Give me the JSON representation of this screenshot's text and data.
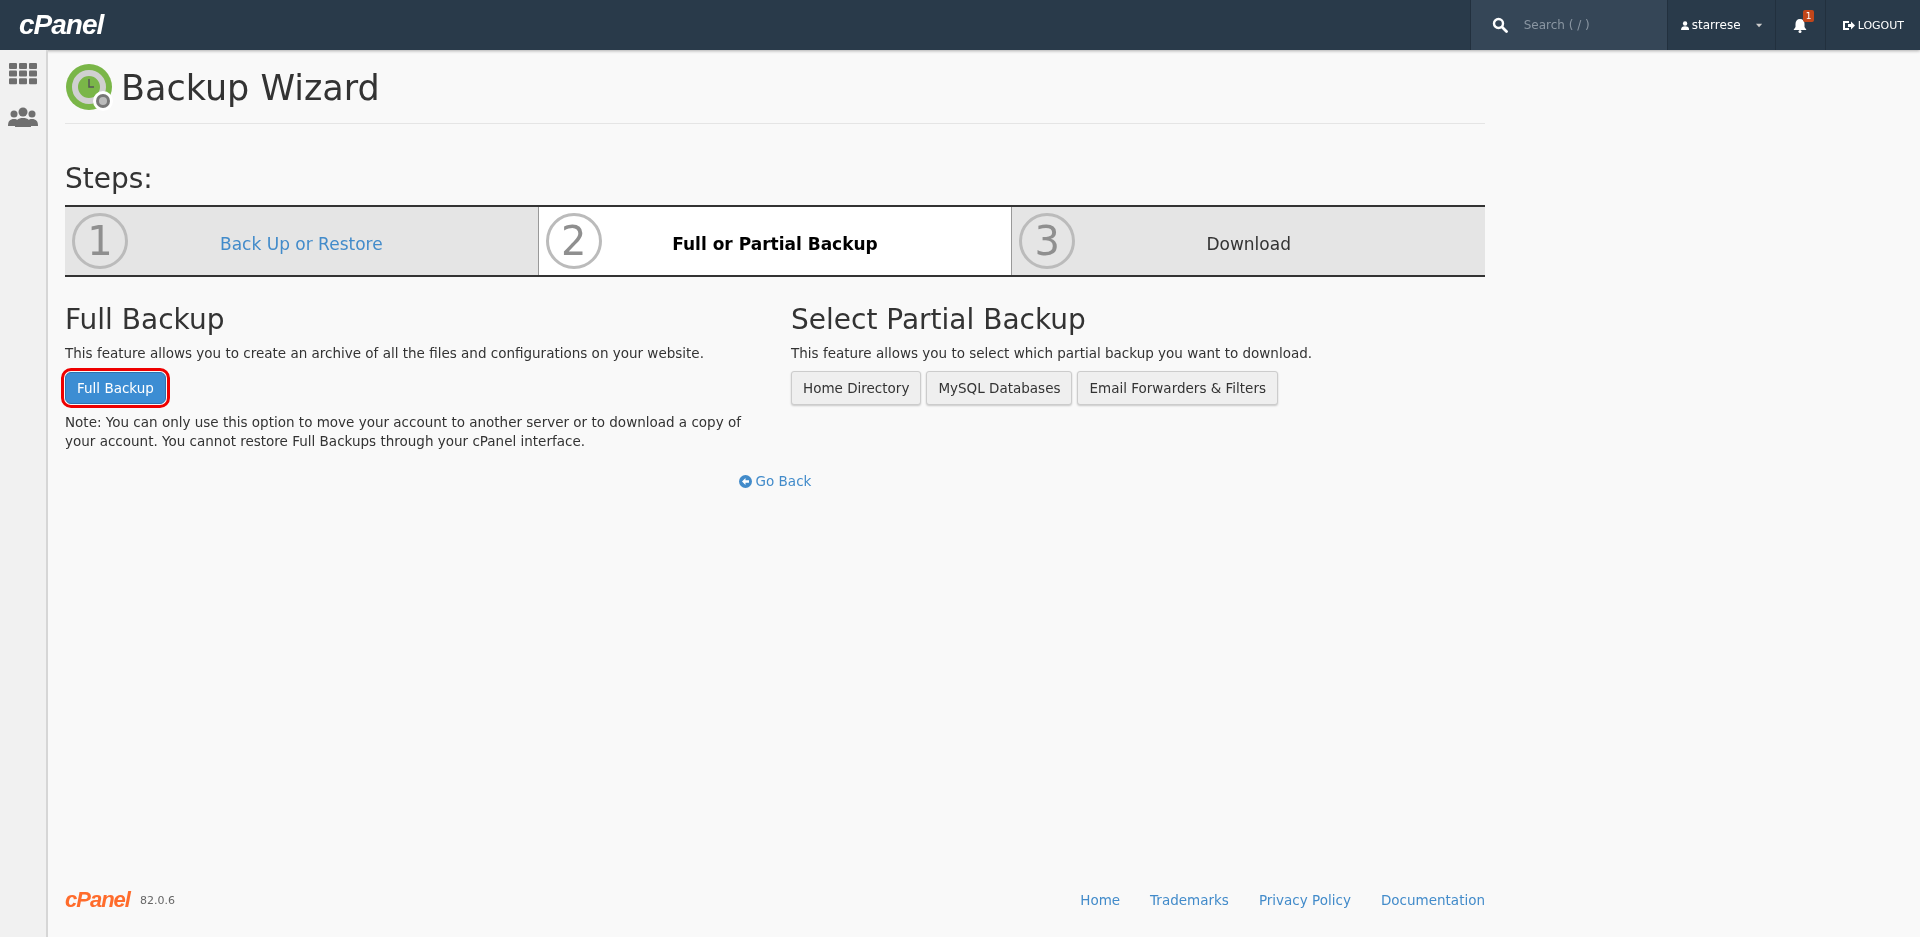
{
  "header": {
    "logo": "cPanel",
    "search": {
      "placeholder": "Search ( / )"
    },
    "user": "starrese",
    "notifications": "1",
    "logout": "LOGOUT"
  },
  "page": {
    "title": "Backup Wizard"
  },
  "steps": {
    "heading": "Steps:",
    "items": [
      {
        "number": "1",
        "label": "Back Up or Restore",
        "selected": false,
        "completed": true
      },
      {
        "number": "2",
        "label": "Full or Partial Backup",
        "selected": true,
        "completed": false
      },
      {
        "number": "3",
        "label": "Download",
        "selected": false,
        "completed": false
      }
    ]
  },
  "full_backup": {
    "heading": "Full Backup",
    "description": "This feature allows you to create an archive of all the files and configurations on your website.",
    "button": {
      "label": "Full Backup",
      "highlighted": true
    },
    "note": "Note: You can only use this option to move your account to another server or to download a copy of your account. You cannot restore Full Backups through your cPanel interface."
  },
  "partial_backup": {
    "heading": "Select Partial Backup",
    "description": "This feature allows you to select which partial backup you want to download.",
    "buttons": [
      "Home Directory",
      "MySQL Databases",
      "Email Forwarders & Filters"
    ]
  },
  "go_back": "Go Back",
  "footer": {
    "logo": "cPanel",
    "version": "82.0.6",
    "links": [
      "Home",
      "Trademarks",
      "Privacy Policy",
      "Documentation"
    ]
  }
}
